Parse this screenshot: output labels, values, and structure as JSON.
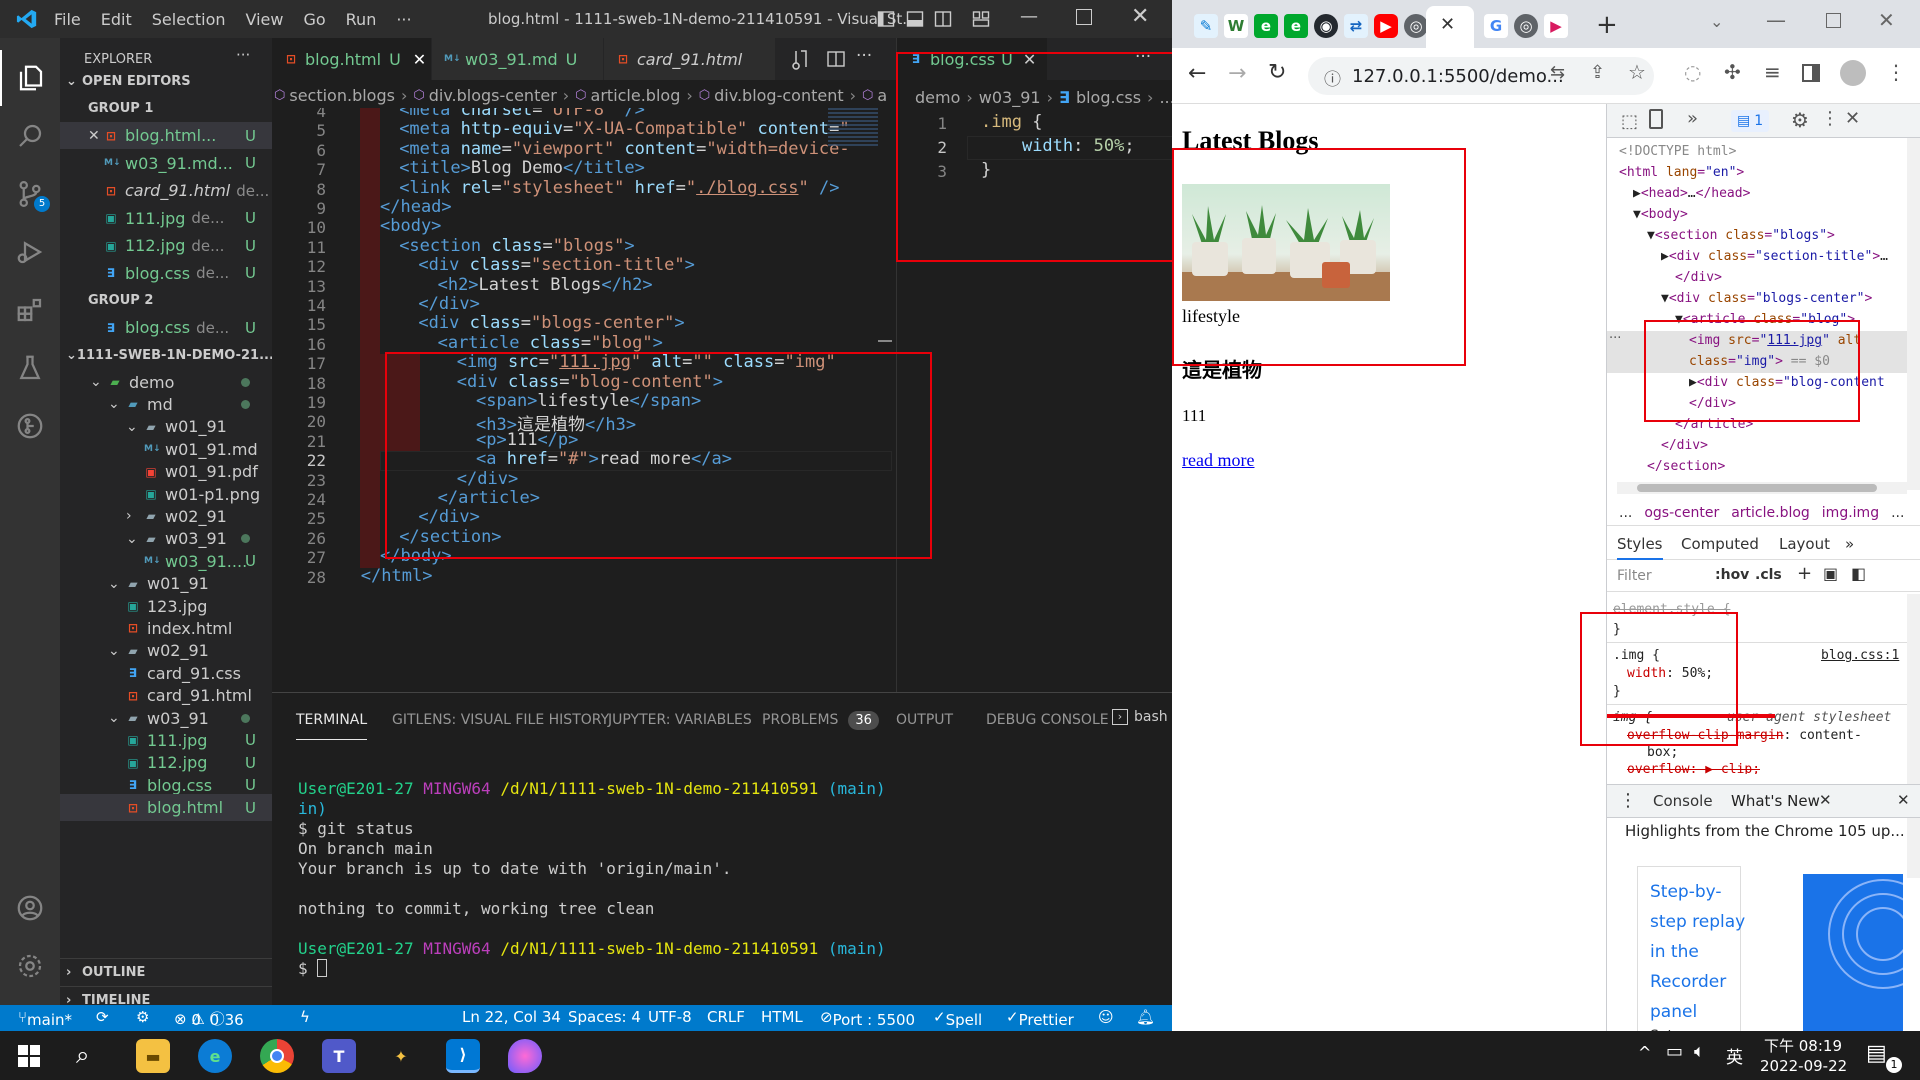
{
  "vscode": {
    "menu": [
      "File",
      "Edit",
      "Selection",
      "View",
      "Go",
      "Run",
      "···"
    ],
    "window_title": "blog.html - 1111-sweb-1N-demo-211410591 - Visual St...",
    "explorer": {
      "title": "EXPLORER",
      "more": "···",
      "open_editors": "OPEN EDITORS",
      "group1": "GROUP 1",
      "group2": "GROUP 2",
      "project": "1111-SWEB-1N-DEMO-21...",
      "outline": "OUTLINE",
      "timeline": "TIMELINE",
      "g1_items": [
        {
          "name": "blog.html...",
          "badge": "U",
          "icon": "html"
        },
        {
          "name": "w03_91.md...",
          "badge": "U",
          "icon": "md"
        },
        {
          "name": "card_91.html",
          "desc": "de...",
          "icon": "html"
        },
        {
          "name": "111.jpg",
          "desc": "de...",
          "badge": "U",
          "icon": "img"
        },
        {
          "name": "112.jpg",
          "desc": "de...",
          "badge": "U",
          "icon": "img"
        },
        {
          "name": "blog.css",
          "desc": "de...",
          "badge": "U",
          "icon": "css"
        }
      ],
      "g2_items": [
        {
          "name": "blog.css",
          "desc": "de...",
          "badge": "U",
          "icon": "css"
        }
      ],
      "tree": [
        {
          "name": "demo",
          "depth": 1,
          "type": "folder",
          "open": true,
          "dot": true
        },
        {
          "name": "md",
          "depth": 2,
          "type": "folder",
          "open": true,
          "dot": true
        },
        {
          "name": "w01_91",
          "depth": 3,
          "type": "folder",
          "open": true
        },
        {
          "name": "w01_91.md",
          "depth": 4,
          "type": "md"
        },
        {
          "name": "w01_91.pdf",
          "depth": 4,
          "type": "pdf"
        },
        {
          "name": "w01-p1.png",
          "depth": 4,
          "type": "img"
        },
        {
          "name": "w02_91",
          "depth": 3,
          "type": "folder",
          "open": false
        },
        {
          "name": "w03_91",
          "depth": 3,
          "type": "folder",
          "open": true,
          "dot": true
        },
        {
          "name": "w03_91....",
          "depth": 4,
          "type": "md",
          "badge": "U"
        },
        {
          "name": "w01_91",
          "depth": 2,
          "type": "folder",
          "open": true
        },
        {
          "name": "123.jpg",
          "depth": 3,
          "type": "img"
        },
        {
          "name": "index.html",
          "depth": 3,
          "type": "html"
        },
        {
          "name": "w02_91",
          "depth": 2,
          "type": "folder",
          "open": true
        },
        {
          "name": "card_91.css",
          "depth": 3,
          "type": "css"
        },
        {
          "name": "card_91.html",
          "depth": 3,
          "type": "html"
        },
        {
          "name": "w03_91",
          "depth": 2,
          "type": "folder",
          "open": true,
          "dot": true
        },
        {
          "name": "111.jpg",
          "depth": 3,
          "type": "img",
          "badge": "U"
        },
        {
          "name": "112.jpg",
          "depth": 3,
          "type": "img",
          "badge": "U"
        },
        {
          "name": "blog.css",
          "depth": 3,
          "type": "css",
          "badge": "U"
        },
        {
          "name": "blog.html",
          "depth": 3,
          "type": "html",
          "badge": "U",
          "selected": true
        }
      ]
    },
    "tabs": [
      {
        "label": "blog.html",
        "mark": "U",
        "icon": "html",
        "active": true
      },
      {
        "label": "w03_91.md",
        "mark": "U",
        "icon": "md"
      },
      {
        "label": "card_91.html",
        "icon": "html",
        "italic": true
      }
    ],
    "tab2": {
      "label": "blog.css",
      "mark": "U",
      "icon": "css"
    },
    "breadcrumb": [
      "section.blogs",
      "div.blogs-center",
      "article.blog",
      "div.blog-content",
      "a"
    ],
    "breadcrumb2": [
      "demo",
      "w03_91",
      "blog.css",
      "..."
    ],
    "code_lines": [
      {
        "n": "4",
        "html": "<span class='tg'>&lt;meta</span> <span class='at'>charset</span>=<span class='st'>\"UTF-8\"</span> <span class='tg'>/&gt;</span>",
        "indent": 2,
        "del": true
      },
      {
        "n": "5",
        "html": "<span class='tg'>&lt;meta</span> <span class='at'>http-equiv</span>=<span class='st'>\"X-UA-Compatible\"</span> <span class='at'>content</span>=<span class='st'>\"</span>",
        "indent": 2,
        "del": true
      },
      {
        "n": "6",
        "html": "<span class='tg'>&lt;meta</span> <span class='at'>name</span>=<span class='st'>\"viewport\"</span> <span class='at'>content</span>=<span class='st'>\"width=device-</span>",
        "indent": 2,
        "del": true
      },
      {
        "n": "7",
        "html": "<span class='tg'>&lt;title&gt;</span><span class='tx'>Blog Demo</span><span class='tg'>&lt;/title&gt;</span>",
        "indent": 2,
        "del": true
      },
      {
        "n": "8",
        "html": "<span class='tg'>&lt;link</span> <span class='at'>rel</span>=<span class='st'>\"stylesheet\"</span> <span class='at'>href</span>=<span class='st'>\"<span class='ul'>./blog.css</span>\"</span> <span class='tg'>/&gt;</span>",
        "indent": 2,
        "del": true
      },
      {
        "n": "9",
        "html": "<span class='tg'>&lt;/head&gt;</span>",
        "indent": 1,
        "del": true
      },
      {
        "n": "10",
        "html": "<span class='tg'>&lt;body&gt;</span>",
        "indent": 1,
        "del": true
      },
      {
        "n": "11",
        "html": "<span class='tg'>&lt;section</span> <span class='at'>class</span>=<span class='st'>\"blogs\"</span><span class='tg'>&gt;</span>",
        "indent": 2,
        "del": true
      },
      {
        "n": "12",
        "html": "<span class='tg'>&lt;div</span> <span class='at'>class</span>=<span class='st'>\"section-title\"</span><span class='tg'>&gt;</span>",
        "indent": 3,
        "del": true
      },
      {
        "n": "13",
        "html": "<span class='tg'>&lt;h2&gt;</span><span class='tx'>Latest Blogs</span><span class='tg'>&lt;/h2&gt;</span>",
        "indent": 4,
        "del": true
      },
      {
        "n": "14",
        "html": "<span class='tg'>&lt;/div&gt;</span>",
        "indent": 3,
        "del": true
      },
      {
        "n": "15",
        "html": "<span class='tg'>&lt;div</span> <span class='at'>class</span>=<span class='st'>\"blogs-center\"</span><span class='tg'>&gt;</span>",
        "indent": 3,
        "del": true
      },
      {
        "n": "16",
        "html": "<span class='tg'>&lt;article</span> <span class='at'>class</span>=<span class='st'>\"blog\"</span><span class='tg'>&gt;</span>",
        "indent": 4,
        "del": true
      },
      {
        "n": "17",
        "html": "<span class='tg'>&lt;img</span> <span class='at'>src</span>=<span class='st'>\"<span class='ul'>111.jpg</span>\"</span> <span class='at'>alt</span>=<span class='st'>\"\"</span> <span class='at'>class</span>=<span class='st'>\"img\"</span>",
        "indent": 5,
        "del": true,
        "hl": true
      },
      {
        "n": "18",
        "html": "<span class='tg'>&lt;div</span> <span class='at'>class</span>=<span class='st'>\"blog-content\"</span><span class='tg'>&gt;</span>",
        "indent": 5,
        "del": true,
        "hl": true
      },
      {
        "n": "19",
        "html": "<span class='tg'>&lt;span&gt;</span><span class='tx'>lifestyle</span><span class='tg'>&lt;/span&gt;</span>",
        "indent": 6,
        "del": true,
        "hl": true
      },
      {
        "n": "20",
        "html": "<span class='tg'>&lt;h3&gt;</span><span class='tx'>這是植物</span><span class='tg'>&lt;/h3&gt;</span>",
        "indent": 6,
        "del": true,
        "hl": true
      },
      {
        "n": "21",
        "html": "<span class='tg'>&lt;p&gt;</span><span class='tx'>111</span><span class='tg'>&lt;/p&gt;</span>",
        "indent": 6,
        "del": true,
        "hl": true
      },
      {
        "n": "22",
        "html": "<span class='tg'>&lt;a</span> <span class='at'>href</span>=<span class='st'>\"#\"</span><span class='tg'>&gt;</span><span class='tx'>read more</span><span class='tg'>&lt;/a&gt;</span>",
        "indent": 6,
        "del": true,
        "cur": true
      },
      {
        "n": "23",
        "html": "<span class='tg'>&lt;/div&gt;</span>",
        "indent": 5,
        "del": true
      },
      {
        "n": "24",
        "html": "<span class='tg'>&lt;/article&gt;</span>",
        "indent": 4,
        "del": true
      },
      {
        "n": "25",
        "html": "<span class='tg'>&lt;/div&gt;</span>",
        "indent": 3,
        "del": true
      },
      {
        "n": "26",
        "html": "<span class='tg'>&lt;/section&gt;</span>",
        "indent": 2,
        "del": true
      },
      {
        "n": "27",
        "html": "<span class='tg'>&lt;/body&gt;</span>",
        "indent": 1,
        "del": true
      },
      {
        "n": "28",
        "html": "<span class='tg'>&lt;/html&gt;</span>",
        "indent": 0,
        "del": false
      }
    ],
    "css_lines": [
      {
        "n": "1",
        "html": "<span style='color:#d7ba7d'>.img</span> <span class='tx'>{</span>"
      },
      {
        "n": "2",
        "html": "    <span class='at'>width</span><span class='tx'>:</span> <span style='color:#b5cea8'>50%</span><span class='tx'>;</span>"
      },
      {
        "n": "3",
        "html": "<span class='tx'>}</span>"
      }
    ],
    "panel_tabs": [
      {
        "label": "TERMINAL",
        "active": true
      },
      {
        "label": "GITLENS: VISUAL FILE HISTORY"
      },
      {
        "label": "JUPYTER: VARIABLES"
      },
      {
        "label": "PROBLEMS",
        "badge": "36"
      },
      {
        "label": "OUTPUT"
      },
      {
        "label": "DEBUG CONSOLE"
      }
    ],
    "shell": "bash",
    "terminal": {
      "prompt1_user": "User@E201-27",
      "prompt1_sys": "MINGW64",
      "prompt1_path": "/d/N1/1111-sweb-1N-demo-211410591",
      "prompt1_branch": "(main)",
      "wrap": "in)",
      "cmd": "$ git status",
      "out1": "On branch main",
      "out2": "Your branch is up to date with 'origin/main'.",
      "out3": "nothing to commit, working tree clean",
      "prompt2_user": "User@E201-27",
      "prompt2_sys": "MINGW64",
      "prompt2_path": "/d/N1/1111-sweb-1N-demo-211410591",
      "prompt2_branch": "(main)",
      "cmd2": "$ "
    },
    "status": {
      "branch": "main*",
      "errors": "0",
      "warnings": "0",
      "info": "36",
      "position": "Ln 22, Col 34",
      "spaces": "Spaces: 4",
      "encoding": "UTF-8",
      "eol": "CRLF",
      "lang": "HTML",
      "port": "Port : 5500",
      "spell": "Spell",
      "prettier": "Prettier"
    }
  },
  "chrome": {
    "url": "127.0.0.1:5500/demo...",
    "page": {
      "heading": "Latest Blogs",
      "category": "lifestyle",
      "title": "這是植物",
      "text": "111",
      "link": "read more"
    },
    "devtools": {
      "console_badge": "1",
      "elements": [
        {
          "i": 0,
          "html": "<span style='color:#888'>&lt;!DOCTYPE html&gt;</span>"
        },
        {
          "i": 0,
          "html": "&lt;html <span class='dt-at'>lang</span>=<span class='dt-av'>\"en\"</span>&gt;"
        },
        {
          "i": 1,
          "html": "<span class='dt-tx'>▶</span>&lt;head&gt;<span class='dt-tx'>…</span>&lt;/head&gt;"
        },
        {
          "i": 1,
          "html": "<span class='dt-tx'>▼</span>&lt;body&gt;"
        },
        {
          "i": 2,
          "html": "<span class='dt-tx'>▼</span>&lt;section <span class='dt-at'>class</span>=<span class='dt-av'>\"blogs\"</span>&gt;"
        },
        {
          "i": 3,
          "html": "<span class='dt-tx'>▶</span>&lt;div <span class='dt-at'>class</span>=<span class='dt-av'>\"section-title\"</span>&gt;<span class='dt-tx'>…</span>"
        },
        {
          "i": 4,
          "html": "&lt;/div&gt;"
        },
        {
          "i": 3,
          "html": "<span class='dt-tx'>▼</span>&lt;div <span class='dt-at'>class</span>=<span class='dt-av'>\"blogs-center\"</span>&gt;"
        },
        {
          "i": 4,
          "html": "<span class='dt-tx'>▼</span>&lt;article <span class='dt-at'>class</span>=<span class='dt-av'>\"blog\"</span>&gt;"
        },
        {
          "i": 5,
          "html": "&lt;img <span class='dt-at'>src</span>=<span class='dt-av'>\"<u>111.jpg</u>\"</span> <span class='dt-at'>alt</span>",
          "sel": true
        },
        {
          "i": 5,
          "html": "<span class='dt-at'>class</span>=<span class='dt-av'>\"img\"</span>&gt; <span style='color:#888'>== $0</span>",
          "sel": true
        },
        {
          "i": 5,
          "html": "<span class='dt-tx'>▶</span>&lt;div <span class='dt-at'>class</span>=<span class='dt-av'>\"blog-content</span>"
        },
        {
          "i": 5,
          "html": "&lt;/div&gt;"
        },
        {
          "i": 4,
          "html": "&lt;/article&gt;"
        },
        {
          "i": 3,
          "html": "&lt;/div&gt;"
        },
        {
          "i": 2,
          "html": "&lt;/section&gt;"
        }
      ],
      "dom_crumbs": [
        "...",
        "ogs-center",
        "article.blog",
        "img.img",
        "..."
      ],
      "style_tabs": [
        "Styles",
        "Computed",
        "Layout",
        "»"
      ],
      "filter": "Filter",
      "hov": ":hov",
      "cls": ".cls",
      "rules": {
        "element_style": "element.style {",
        "close1": "}",
        "img_sel": ".img {",
        "img_src": "blog.css:1",
        "img_prop": "width",
        "img_val": "50%;",
        "close2": "}",
        "ua_sel": "img {",
        "ua_src": "user agent stylesheet",
        "ua_prop": "overflow-clip-margin",
        "ua_val": "content-",
        "ua_val2": "box;",
        "ua_prop2": "overflow: ▶ clip;"
      },
      "drawer_tabs": [
        "Console",
        "What's New"
      ],
      "highlights": "Highlights from the Chrome 105 up...",
      "card_text": [
        "Step-by-",
        "step replay",
        "in the",
        "Recorder",
        "panel",
        "Set a..."
      ]
    }
  },
  "taskbar": {
    "time": "下午 08:19",
    "date": "2022-09-22",
    "ime": "英",
    "notif": "1"
  }
}
